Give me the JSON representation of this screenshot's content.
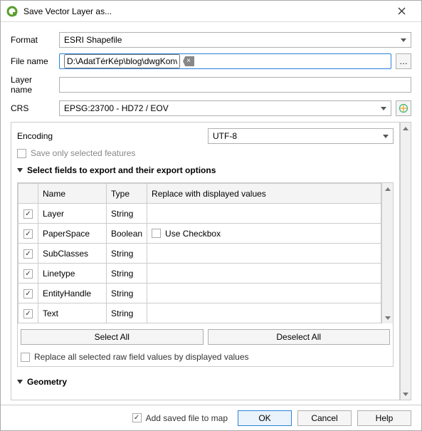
{
  "window": {
    "title": "Save Vector Layer as..."
  },
  "labels": {
    "format": "Format",
    "file_name": "File name",
    "layer_name": "Layer name",
    "crs": "CRS",
    "encoding": "Encoding",
    "save_only_selected": "Save only selected features",
    "fields_section": "Select fields to export and their export options",
    "geometry_section": "Geometry",
    "replace_all": "Replace all selected raw field values by displayed values",
    "add_saved": "Add saved file to map",
    "browse": "…"
  },
  "values": {
    "format": "ESRI Shapefile",
    "file_name": "D:\\AdatTérKép\\blog\\dwgKonvertalasaShpFormatumba\\lakoepulet.shp",
    "layer_name": "",
    "crs": "EPSG:23700 - HD72 / EOV",
    "encoding": "UTF-8"
  },
  "table": {
    "headers": {
      "name": "Name",
      "type": "Type",
      "replace": "Replace with displayed values"
    },
    "rows": [
      {
        "name": "Layer",
        "type": "String",
        "replace": ""
      },
      {
        "name": "PaperSpace",
        "type": "Boolean",
        "replace": "Use Checkbox"
      },
      {
        "name": "SubClasses",
        "type": "String",
        "replace": ""
      },
      {
        "name": "Linetype",
        "type": "String",
        "replace": ""
      },
      {
        "name": "EntityHandle",
        "type": "String",
        "replace": ""
      },
      {
        "name": "Text",
        "type": "String",
        "replace": ""
      }
    ]
  },
  "buttons": {
    "select_all": "Select All",
    "deselect_all": "Deselect All",
    "ok": "OK",
    "cancel": "Cancel",
    "help": "Help"
  }
}
